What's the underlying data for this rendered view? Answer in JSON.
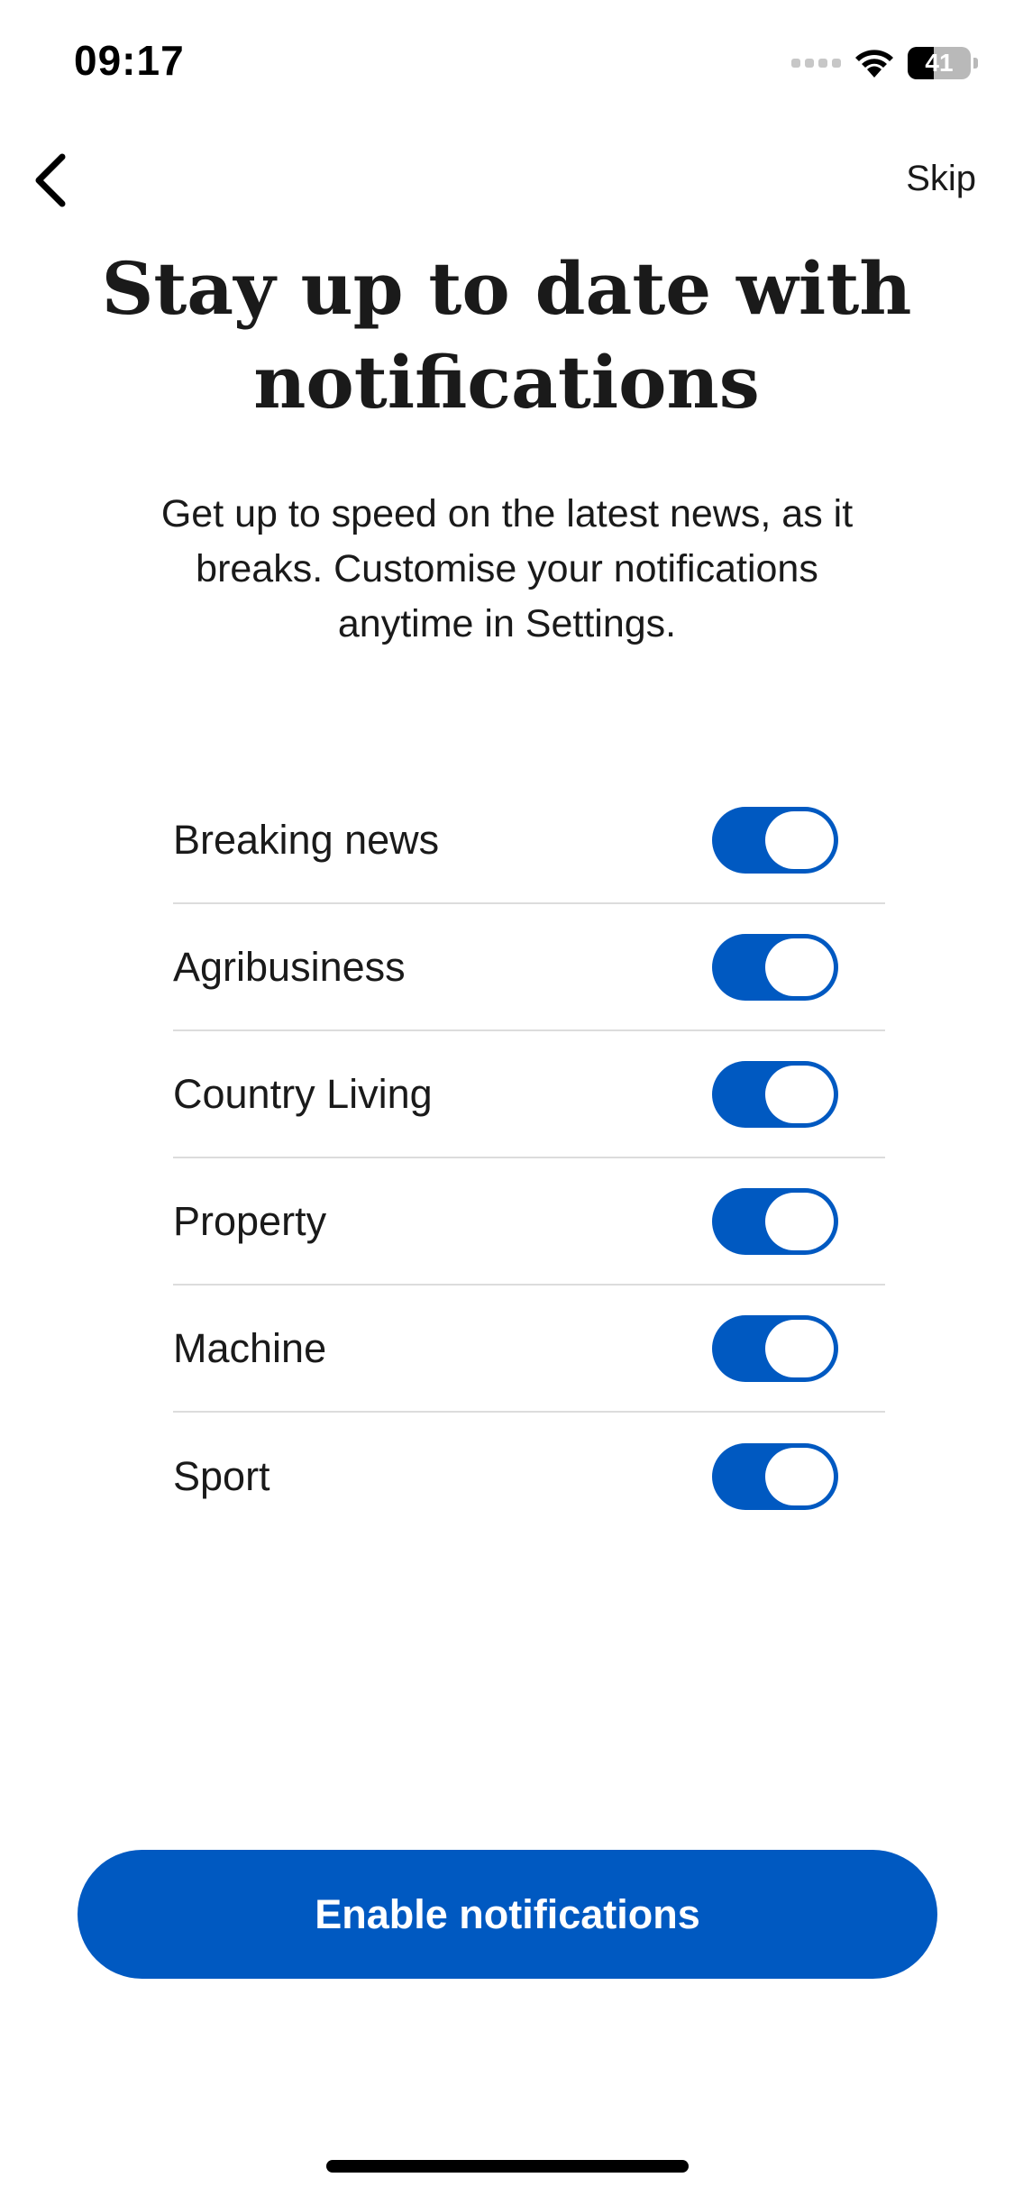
{
  "status_bar": {
    "time": "09:17",
    "battery_level": 41,
    "battery_text": "41",
    "icons": [
      "signal-icon",
      "wifi-icon",
      "battery-icon"
    ]
  },
  "nav": {
    "back_icon": "chevron-left-icon",
    "skip_label": "Skip"
  },
  "header": {
    "title": "Stay up to date with notifications",
    "subtitle": "Get up to speed on the latest news, as it breaks. Customise your notifications anytime in Settings."
  },
  "topics": [
    {
      "label": "Breaking news",
      "enabled": true
    },
    {
      "label": "Agribusiness",
      "enabled": true
    },
    {
      "label": "Country Living",
      "enabled": true
    },
    {
      "label": "Property",
      "enabled": true
    },
    {
      "label": "Machine",
      "enabled": true
    },
    {
      "label": "Sport",
      "enabled": true
    }
  ],
  "cta": {
    "label": "Enable notifications"
  },
  "colors": {
    "accent": "#0059c1",
    "text": "#1a1a1a",
    "divider": "#dcdcdc"
  }
}
